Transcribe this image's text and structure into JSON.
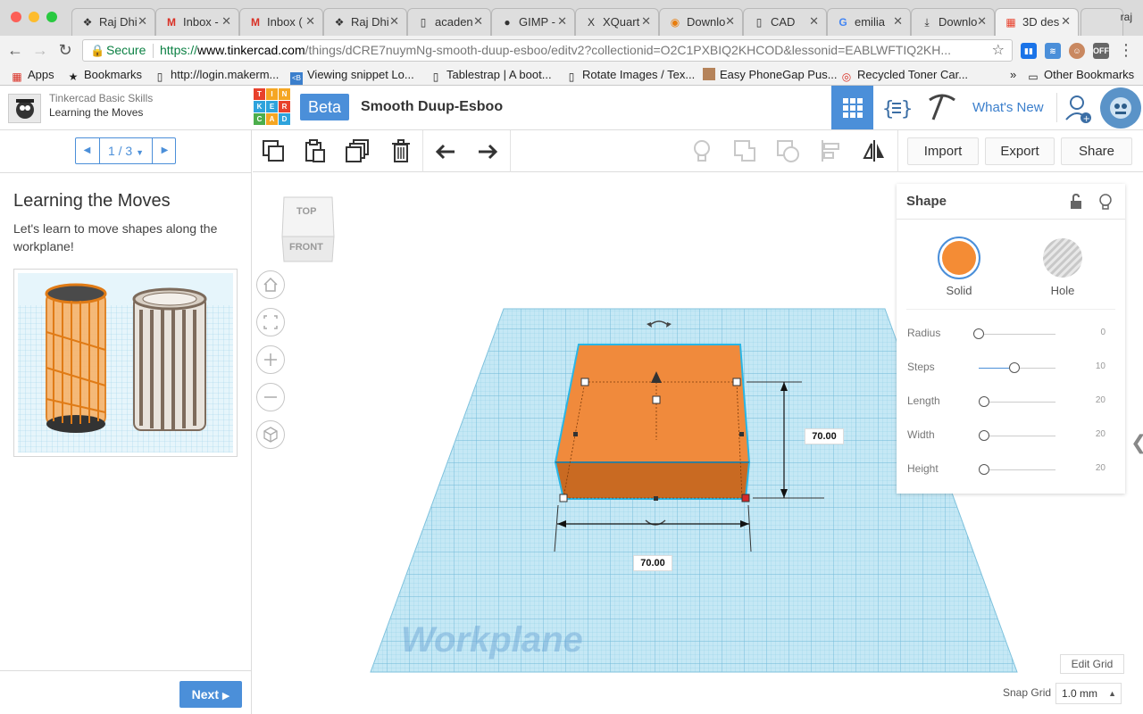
{
  "browser": {
    "tabs": [
      {
        "title": "Raj Dhi",
        "icon": "tinkercad-favicon"
      },
      {
        "title": "Inbox -",
        "icon": "gmail-favicon"
      },
      {
        "title": "Inbox (",
        "icon": "gmail-favicon"
      },
      {
        "title": "Raj Dhi",
        "icon": "tinkercad-favicon"
      },
      {
        "title": "acaden",
        "icon": "document-favicon"
      },
      {
        "title": "GIMP -",
        "icon": "gimp-favicon"
      },
      {
        "title": "XQuart",
        "icon": "xquartz-favicon"
      },
      {
        "title": "Downlo",
        "icon": "blender-favicon"
      },
      {
        "title": "CAD",
        "icon": "document-favicon"
      },
      {
        "title": "emilia",
        "icon": "google-favicon"
      },
      {
        "title": "Downlo",
        "icon": "download-favicon"
      },
      {
        "title": "3D des",
        "icon": "tinkercad-favicon",
        "active": true
      }
    ],
    "profile_name": "raj",
    "security_label": "Secure",
    "url_scheme": "https://",
    "url_host": "www.tinkercad.com",
    "url_path": "/things/dCRE7nuymNg-smooth-duup-esboo/editv2?collectionid=O2C1PXBIQ2KHCOD&lessonid=EABLWFTIQ2KH...",
    "bookmarks": [
      {
        "label": "Apps",
        "icon": "apps-grid-icon"
      },
      {
        "label": "Bookmarks",
        "icon": "star-icon"
      },
      {
        "label": "http://login.makerm...",
        "icon": "page-icon"
      },
      {
        "label": "Viewing snippet Lo...",
        "icon": "bootsnipp-icon"
      },
      {
        "label": "Tablestrap | A boot...",
        "icon": "page-icon"
      },
      {
        "label": "Rotate Images / Tex...",
        "icon": "page-icon"
      },
      {
        "label": "Easy PhoneGap Pus...",
        "icon": "photo-icon"
      },
      {
        "label": "Recycled Toner Car...",
        "icon": "recycle-icon"
      }
    ],
    "other_bookmarks": "Other Bookmarks",
    "overflow": "»"
  },
  "app": {
    "lesson_course": "Tinkercad Basic Skills",
    "lesson_name": "Learning the Moves",
    "logo_letters": [
      "TIN",
      "KER",
      "CAD"
    ],
    "beta_label": "Beta",
    "design_title": "Smooth Duup-Esboo",
    "whats_new": "What's New"
  },
  "lesson": {
    "pager": "1 / 3",
    "step_title": "Learning the Moves",
    "step_description": "Let's learn to move shapes along the workplane!",
    "next_label": "Next"
  },
  "toolbar": {
    "import": "Import",
    "export": "Export",
    "share": "Share"
  },
  "workspace": {
    "viewcube_top": "TOP",
    "viewcube_front": "FRONT",
    "dim_height": "70.00",
    "dim_width": "70.00",
    "workplane_label": "Workplane",
    "edit_grid": "Edit Grid",
    "snap_grid_label": "Snap Grid",
    "snap_grid_value": "1.0 mm"
  },
  "inspector": {
    "title": "Shape",
    "solid_label": "Solid",
    "hole_label": "Hole",
    "properties": [
      {
        "label": "Radius",
        "value": "0"
      },
      {
        "label": "Steps",
        "value": "10"
      },
      {
        "label": "Length",
        "value": "20"
      },
      {
        "label": "Width",
        "value": "20"
      },
      {
        "label": "Height",
        "value": "20"
      }
    ]
  },
  "colors": {
    "accent": "#4b8fd9",
    "shape_orange": "#f08a3c",
    "grid_blue": "#a9dbee"
  }
}
